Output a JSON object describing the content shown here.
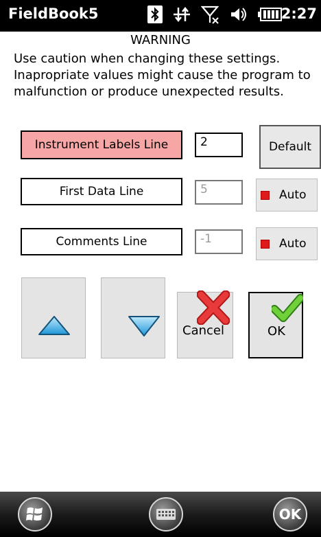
{
  "status_bar": {
    "app_title": "FieldBook5",
    "time": "2:27",
    "icons": [
      "bluetooth-icon",
      "data-sync-icon",
      "no-signal-icon",
      "volume-icon",
      "battery-icon"
    ]
  },
  "warning": {
    "title": "WARNING",
    "text": "Use caution when changing these settings. Inapropriate values might cause the program to malfunction or produce unexpected results."
  },
  "rows": {
    "instrument": {
      "label": "Instrument Labels Line",
      "value": "2"
    },
    "first_data": {
      "label": "First Data Line",
      "value": "5"
    },
    "comments": {
      "label": "Comments Line",
      "value": "-1"
    }
  },
  "buttons": {
    "default": "Default",
    "auto1": "Auto",
    "auto2": "Auto",
    "cancel": "Cancel",
    "ok": "OK"
  },
  "taskbar": {
    "ok": "OK",
    "icons": [
      "windows-start-icon",
      "keyboard-icon"
    ]
  },
  "colors": {
    "highlight": "#f7a6a6",
    "checkbox_red": "#e01a1a",
    "arrow_blue": "#2fa8e6",
    "cancel_red": "#e03030",
    "ok_green": "#5cbf2a"
  }
}
